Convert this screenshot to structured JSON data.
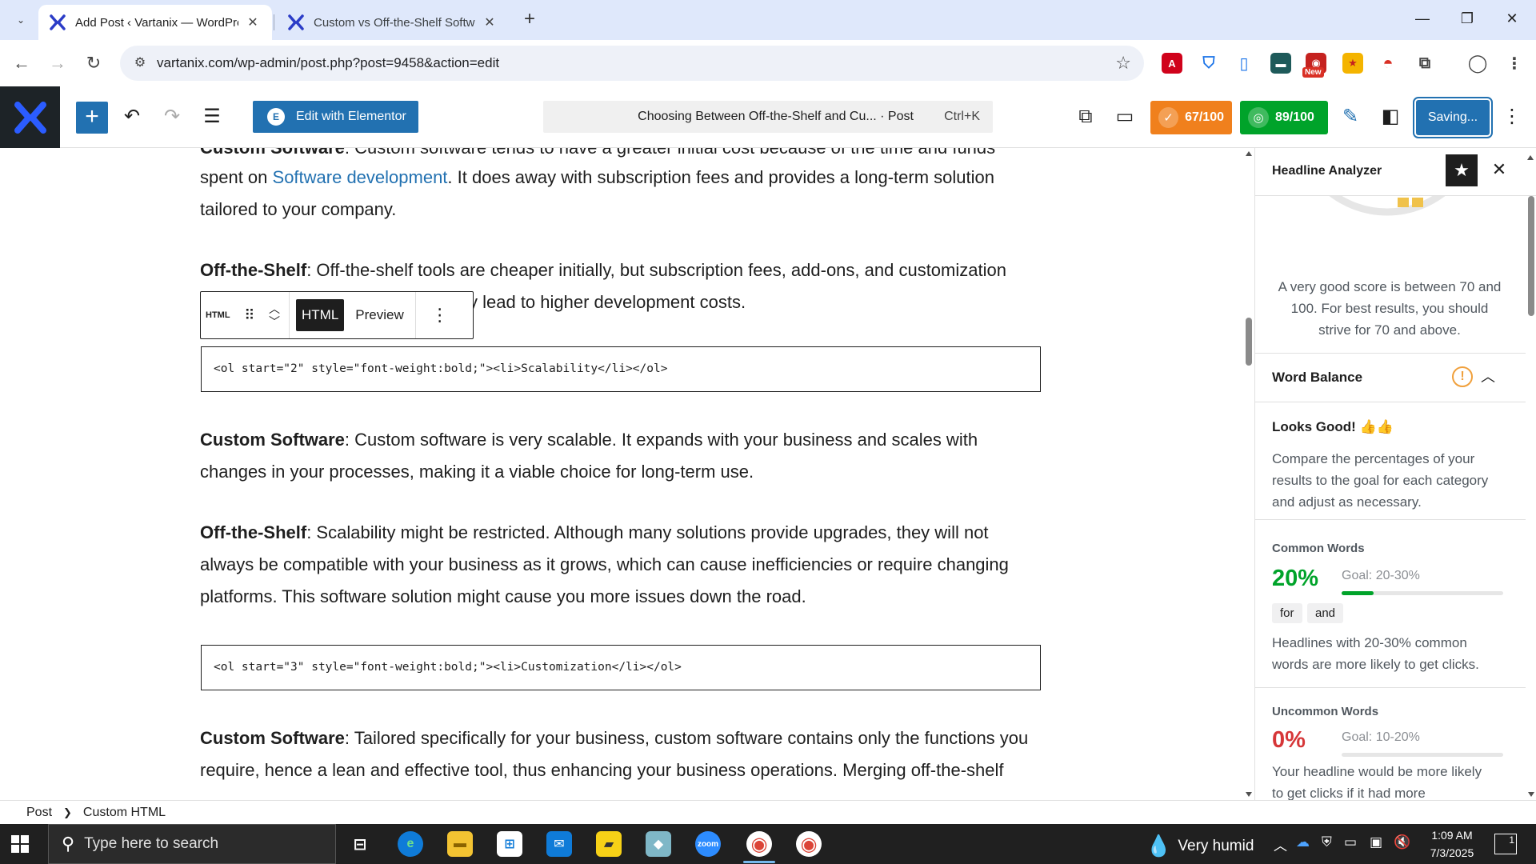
{
  "browser": {
    "tabs": [
      {
        "title": "Add Post ‹ Vartanix — WordPre",
        "active": true
      },
      {
        "title": "Custom vs Off-the-Shelf Softwa",
        "active": false
      }
    ],
    "new_tab": "+",
    "url": "vartanix.com/wp-admin/post.php?post=9458&action=edit",
    "ext_badge": "New",
    "window_controls": {
      "minimize": "—",
      "restore": "❐",
      "close": "✕"
    }
  },
  "wp": {
    "elementor_label": "Edit with Elementor",
    "command_title": "Choosing Between Off-the-Shelf and Cu... · Post",
    "command_shortcut": "Ctrl+K",
    "seo_score": "67/100",
    "headline_score": "89/100",
    "saving_label": "Saving..."
  },
  "content": {
    "p1_bold": "Custom Software",
    "p1_rest": ": Custom software tends to have a greater initial cost because of the time and funds",
    "p2_pre": "spent on ",
    "p2_link": "Software development",
    "p2_post": ". It does away with subscription fees and provides a long-term solution",
    "p3": "tailored to your company.",
    "p4_bold": "Off-the-Shelf",
    "p4_rest": ": Off-the-shelf tools are cheaper initially, but subscription fees, add-ons, and customization",
    "p5": "y lead to higher development costs.",
    "code1": "<ol start=\"2\" style=\"font-weight:bold;\"><li>Scalability</li></ol>",
    "p6_bold": "Custom Software",
    "p6_rest": ": Custom software is very scalable. It expands with your business and scales with",
    "p7": "changes in your processes, making it a viable choice for long-term use.",
    "p8_bold": "Off-the-Shelf",
    "p8_rest": ": Scalability might be restricted. Although many solutions provide upgrades, they will not",
    "p9": "always be compatible with your business as it grows, which can cause inefficiencies or require changing",
    "p10": "platforms. This software solution might cause you more issues down the road.",
    "code2": "<ol start=\"3\" style=\"font-weight:bold;\"><li>Customization</li></ol>",
    "p11_bold": "Custom Software",
    "p11_rest": ": Tailored specifically for your business, custom software contains only the functions you",
    "p12": "require, hence a lean and effective tool, thus enhancing your business operations. Merging off-the-shelf"
  },
  "block_toolbar": {
    "type_label": "HTML",
    "html_tab": "HTML",
    "preview_tab": "Preview"
  },
  "sidebar": {
    "title": "Headline Analyzer",
    "score_note": [
      "A very good score is between 70 and",
      "100. For best results, you should",
      "strive for 70 and above."
    ],
    "word_balance_title": "Word Balance",
    "looks_good": "Looks Good! 👍👍",
    "compare_text": [
      "Compare the percentages of your",
      "results to the goal for each category",
      "and adjust as necessary."
    ],
    "common": {
      "label": "Common Words",
      "pct": "20%",
      "pct_value": 20,
      "goal": "Goal: 20-30%",
      "chips": [
        "for",
        "and"
      ],
      "note": [
        "Headlines with 20-30% common",
        "words are more likely to get clicks."
      ],
      "color": "#00a32a"
    },
    "uncommon": {
      "label": "Uncommon Words",
      "pct": "0%",
      "pct_value": 0,
      "goal": "Goal: 10-20%",
      "note": [
        "Your headline would be more likely",
        "to get clicks if it had more"
      ],
      "color": "#d63638"
    }
  },
  "footer": {
    "crumb1": "Post",
    "crumb2": "Custom HTML"
  },
  "taskbar": {
    "search_placeholder": "Type here to search",
    "weather": "Very humid",
    "time": "1:09 AM",
    "date": "7/3/2025",
    "notif_count": "1"
  },
  "colors": {
    "wp_blue": "#2271b1",
    "seo_orange": "#f0801d",
    "headline_green": "#00a32a"
  }
}
